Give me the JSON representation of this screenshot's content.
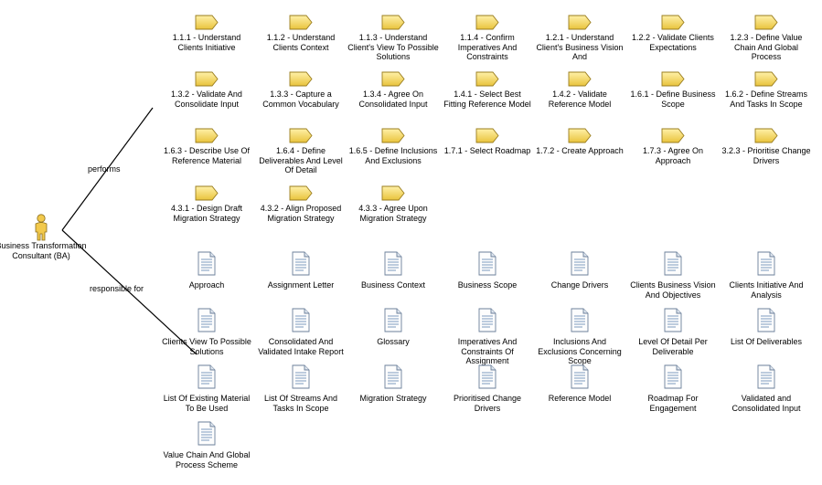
{
  "actor": {
    "name": "Business Transformation Consultant (BA)",
    "icon": "person-icon"
  },
  "relations": {
    "performs": "performs",
    "responsible_for": "responsible for"
  },
  "processes": [
    "1.1.1 - Understand Clients Initiative",
    "1.1.2 - Understand Clients Context",
    "1.1.3 - Understand Client's View To Possible Solutions",
    "1.1.4 - Confirm Imperatives And Constraints",
    "1.2.1 - Understand Client's Business Vision And",
    "1.2.2 - Validate Clients Expectations",
    "1.2.3 - Define Value Chain And Global Process",
    "1.3.2 - Validate And Consolidate Input",
    "1.3.3 - Capture a Common Vocabulary",
    "1.3.4 - Agree On Consolidated Input",
    "1.4.1 - Select Best Fitting Reference Model",
    "1.4.2 - Validate Reference Model",
    "1.6.1 - Define Business Scope",
    "1.6.2 - Define Streams And Tasks In Scope",
    "1.6.3 - Describe Use Of Reference Material",
    "1.6.4 - Define Deliverables And Level Of Detail",
    "1.6.5 - Define Inclusions And Exclusions",
    "1.7.1 - Select Roadmap",
    "1.7.2 - Create Approach",
    "1.7.3 - Agree On Approach",
    "3.2.3 - Prioritise Change Drivers",
    "4.3.1 - Design Draft Migration Strategy",
    "4.3.2 - Align Proposed Migration Strategy",
    "4.3.3 - Agree Upon Migration Strategy"
  ],
  "documents": [
    "Approach",
    "Assignment Letter",
    "Business Context",
    "Business Scope",
    "Change Drivers",
    "Clients Business Vision And Objectives",
    "Clients Initiative And Analysis",
    "Clients View To Possible Solutions",
    "Consolidated And Validated Intake Report",
    "Glossary",
    "Imperatives And Constraints Of Assignment",
    "Inclusions And Exclusions Concerning Scope",
    "Level Of Detail Per Deliverable",
    "List Of Deliverables",
    "List Of Existing Material To Be Used",
    "List Of Streams And Tasks In Scope",
    "Migration Strategy",
    "Prioritised Change Drivers",
    "Reference Model",
    "Roadmap For Engagement",
    "Validated and Consolidated Input",
    "Value Chain And Global Process Scheme"
  ]
}
